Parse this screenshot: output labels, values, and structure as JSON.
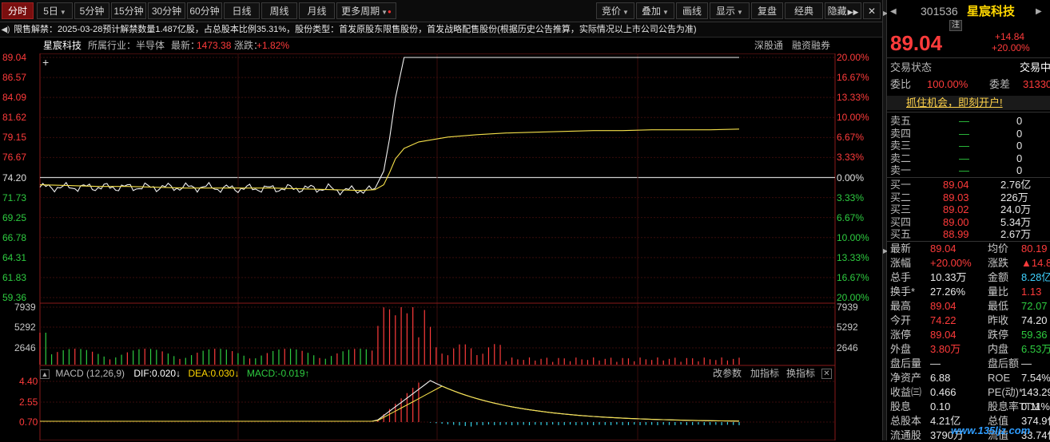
{
  "toolbar": {
    "periods": [
      "分时",
      "5日",
      "5分钟",
      "15分钟",
      "30分钟",
      "60分钟",
      "日线",
      "周线",
      "月线",
      "更多周期"
    ],
    "right_buttons": [
      "竞价",
      "叠加",
      "画线",
      "显示",
      "复盘",
      "经典",
      "隐藏"
    ]
  },
  "notice": {
    "text": "限售解禁：2025-03-28预计解禁数量1.487亿股，占总股本比例35.31%，股份类型：首发原股东限售股份，首发战略配售股份(根据历史公告推算，实际情况以上市公司公告为准)"
  },
  "info": {
    "name": "星宸科技",
    "industry_label": "所属行业：半导体",
    "latest_label": "最新：",
    "latest_value": "1473.38",
    "change_label": "涨跌：",
    "change_value": "+1.82%",
    "btn1": "深股通",
    "btn2": "融资融券"
  },
  "price_axis": [
    "89.04",
    "86.57",
    "84.09",
    "81.62",
    "79.15",
    "76.67",
    "74.20",
    "71.73",
    "69.25",
    "66.78",
    "64.31",
    "61.83",
    "59.36"
  ],
  "pct_axis": [
    "20.00%",
    "16.67%",
    "13.33%",
    "10.00%",
    "6.67%",
    "3.33%",
    "0.00%",
    "3.33%",
    "6.67%",
    "10.00%",
    "13.33%",
    "16.67%",
    "20.00%"
  ],
  "volume_axis": [
    "7939",
    "5292",
    "2646"
  ],
  "macd": {
    "title": "MACD (12,26,9)",
    "dif": "DIF:0.020↓",
    "dea": "DEA:0.030↓",
    "macd": "MACD:-0.019↑",
    "axis": [
      "4.40",
      "2.55",
      "0.70",
      "-1.15"
    ],
    "btn1": "改参数",
    "btn2": "加指标",
    "btn3": "换指标"
  },
  "chart_data": {
    "type": "line",
    "title": "",
    "prev_close": 74.2,
    "ylim": [
      59.36,
      89.04
    ],
    "series": [
      {
        "name": "",
        "x": [
          0,
          10,
          20,
          30,
          40,
          50,
          60,
          70,
          80,
          90,
          100,
          110,
          115,
          118,
          120,
          122,
          125,
          130,
          140,
          150,
          160,
          170,
          180,
          190,
          200,
          210,
          220,
          230,
          240
        ],
        "values": [
          73.4,
          73.1,
          73.0,
          73.0,
          72.8,
          72.9,
          72.8,
          72.9,
          73.0,
          72.6,
          72.5,
          72.4,
          72.8,
          75.0,
          79.0,
          84.0,
          89.04,
          89.04,
          89.04,
          89.04,
          89.04,
          89.04,
          89.04,
          89.04,
          89.04,
          89.04,
          89.04,
          89.04,
          89.04
        ]
      },
      {
        "name": "",
        "x": [
          0,
          10,
          20,
          30,
          40,
          50,
          60,
          70,
          80,
          90,
          100,
          110,
          115,
          118,
          120,
          122,
          125,
          130,
          140,
          150,
          160,
          170,
          180,
          190,
          200,
          210,
          220,
          230,
          240
        ],
        "values": [
          73.3,
          73.2,
          73.1,
          73.1,
          73.0,
          72.9,
          72.9,
          72.9,
          72.9,
          72.8,
          72.7,
          72.6,
          72.7,
          73.3,
          74.8,
          76.5,
          77.8,
          78.6,
          79.2,
          79.5,
          79.7,
          79.8,
          79.9,
          80.0,
          80.0,
          80.1,
          80.1,
          80.1,
          80.19
        ]
      }
    ]
  },
  "right": {
    "code": "301536",
    "name": "星宸科技",
    "tags": [
      "融",
      "港",
      "注"
    ],
    "price": "89.04",
    "change": "+14.84",
    "pct": "+20.00%",
    "status_label": "交易状态",
    "status_value": "交易中",
    "weibi_label": "委比",
    "weibi_value": "100.00%",
    "weicha_label": "委差",
    "weicha_value": "31330",
    "promo": "抓住机会，即刻开户!",
    "asks": [
      {
        "label": "卖五",
        "price": "—",
        "vol": "0"
      },
      {
        "label": "卖四",
        "price": "—",
        "vol": "0"
      },
      {
        "label": "卖三",
        "price": "—",
        "vol": "0"
      },
      {
        "label": "卖二",
        "price": "—",
        "vol": "0"
      },
      {
        "label": "卖一",
        "price": "—",
        "vol": "0"
      }
    ],
    "bids": [
      {
        "label": "买一",
        "price": "89.04",
        "vol": "2.76亿"
      },
      {
        "label": "买二",
        "price": "89.03",
        "vol": "226万"
      },
      {
        "label": "买三",
        "price": "89.02",
        "vol": "24.0万"
      },
      {
        "label": "买四",
        "price": "89.00",
        "vol": "5.34万"
      },
      {
        "label": "买五",
        "price": "88.99",
        "vol": "2.67万"
      }
    ],
    "stats": [
      {
        "l1": "最新",
        "v1": "89.04",
        "c1": "red",
        "l2": "均价",
        "v2": "80.19",
        "c2": "red"
      },
      {
        "l1": "涨幅",
        "v1": "+20.00%",
        "c1": "red",
        "l2": "涨跌",
        "v2": "▲14.84",
        "c2": "red"
      },
      {
        "l1": "总手",
        "v1": "10.33万",
        "c1": "white",
        "l2": "金额",
        "v2": "8.28亿",
        "c2": "cyan"
      },
      {
        "l1": "换手*",
        "v1": "27.26%",
        "c1": "white",
        "l2": "量比",
        "v2": "1.13",
        "c2": "red"
      },
      {
        "l1": "最高",
        "v1": "89.04",
        "c1": "red",
        "l2": "最低",
        "v2": "72.07",
        "c2": "green"
      },
      {
        "l1": "今开",
        "v1": "74.22",
        "c1": "red",
        "l2": "昨收",
        "v2": "74.20",
        "c2": "white"
      },
      {
        "l1": "涨停",
        "v1": "89.04",
        "c1": "red",
        "l2": "跌停",
        "v2": "59.36",
        "c2": "green"
      },
      {
        "l1": "外盘",
        "v1": "3.80万",
        "c1": "red",
        "l2": "内盘",
        "v2": "6.53万",
        "c2": "green"
      },
      {
        "l1": "盘后量",
        "v1": "—",
        "c1": "white",
        "l2": "盘后额",
        "v2": "—",
        "c2": "white"
      },
      {
        "l1": "净资产",
        "v1": "6.88",
        "c1": "white",
        "l2": "ROE",
        "v2": "7.54%",
        "c2": "white"
      },
      {
        "l1": "收益㈢",
        "v1": "0.466",
        "c1": "white",
        "l2": "PE(动)*",
        "v2": "143.29",
        "c2": "white"
      },
      {
        "l1": "股息",
        "v1": "0.10",
        "c1": "white",
        "l2": "股息率TTM",
        "v2": "0.11%",
        "c2": "white"
      },
      {
        "l1": "总股本",
        "v1": "4.21亿",
        "c1": "white",
        "l2": "总值",
        "v2": "374.9亿",
        "c2": "white"
      },
      {
        "l1": "流通股",
        "v1": "3790万",
        "c1": "white",
        "l2": "流值",
        "v2": "33.74亿",
        "c2": "white"
      }
    ]
  },
  "watermark": "www.135ljz.com"
}
